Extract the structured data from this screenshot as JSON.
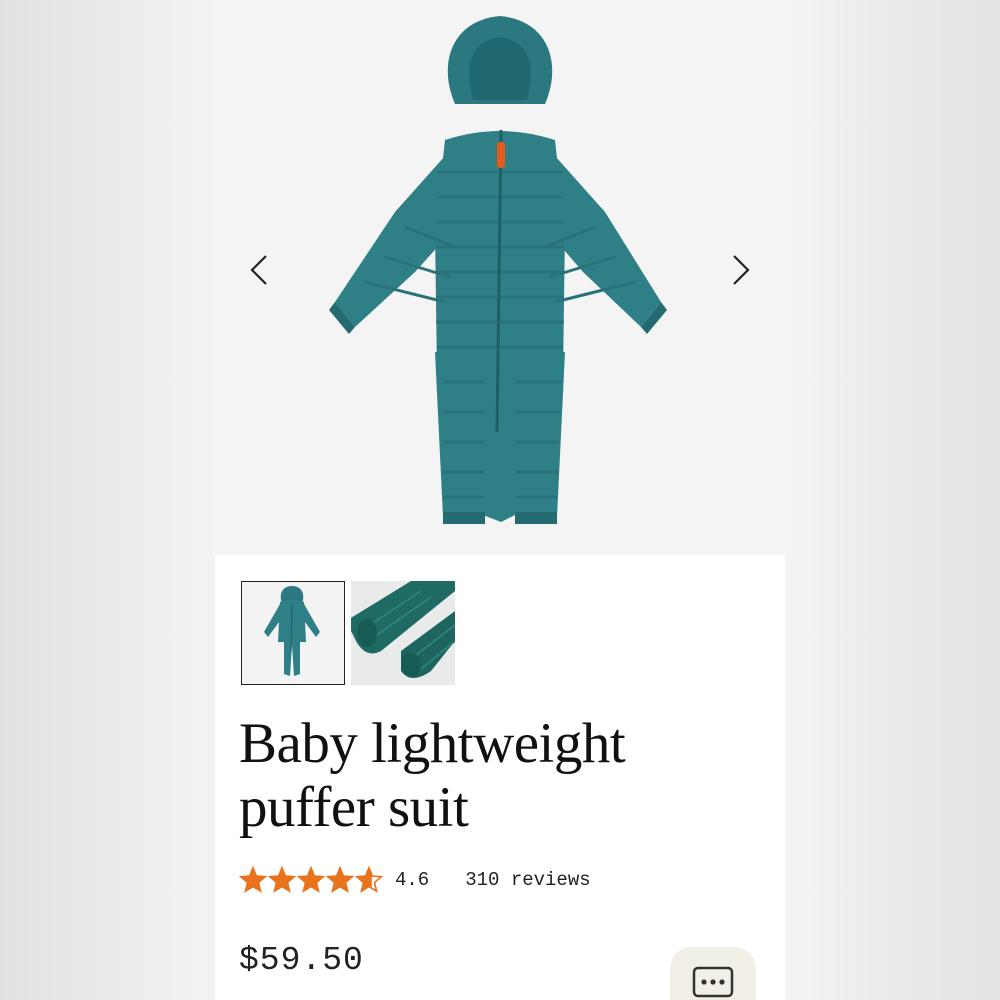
{
  "product": {
    "title_line1": "Baby lightweight",
    "title_line2": "puffer suit",
    "rating_value": "4.6",
    "rating_stars": 4.6,
    "reviews_text": "310 reviews",
    "price": "$59.50"
  },
  "gallery": {
    "active_index": 0,
    "thumbnail_count": 2
  },
  "icons": {
    "prev": "chevron-left-icon",
    "next": "chevron-right-icon",
    "star": "star-icon",
    "chat": "chat-bubble-icon"
  },
  "colors": {
    "product_teal": "#2f7f86",
    "star_orange": "#e8731c",
    "zipper_pull": "#e65a1e"
  }
}
